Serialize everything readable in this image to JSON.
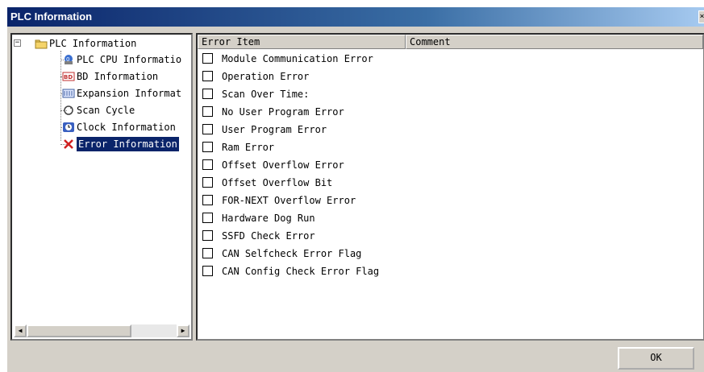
{
  "window": {
    "title": "PLC Information"
  },
  "tree": {
    "root": {
      "label": "PLC Information",
      "expander": "−",
      "icon": "folder-icon"
    },
    "items": [
      {
        "label": "PLC CPU Informatio",
        "icon": "cpu-globe-icon",
        "selected": false
      },
      {
        "label": "BD Information",
        "icon": "bd-board-icon",
        "selected": false
      },
      {
        "label": "Expansion Informat",
        "icon": "expansion-module-icon",
        "selected": false
      },
      {
        "label": "Scan Cycle",
        "icon": "refresh-cycle-icon",
        "selected": false
      },
      {
        "label": "Clock Information",
        "icon": "clock-icon",
        "selected": false
      },
      {
        "label": "Error Information",
        "icon": "error-x-icon",
        "selected": true
      }
    ]
  },
  "list": {
    "columns": [
      "Error Item",
      "Comment"
    ],
    "errors": [
      {
        "label": "Module Communication Error",
        "checked": false
      },
      {
        "label": "Operation Error",
        "checked": false
      },
      {
        "label": "Scan Over Time:",
        "checked": false
      },
      {
        "label": "No User Program Error",
        "checked": false
      },
      {
        "label": "User Program Error",
        "checked": false
      },
      {
        "label": "Ram Error",
        "checked": false
      },
      {
        "label": "Offset Overflow Error",
        "checked": false
      },
      {
        "label": "Offset Overflow Bit",
        "checked": false
      },
      {
        "label": "FOR-NEXT Overflow Error",
        "checked": false
      },
      {
        "label": "Hardware Dog Run",
        "checked": false
      },
      {
        "label": "SSFD Check Error",
        "checked": false
      },
      {
        "label": "CAN Selfcheck Error Flag",
        "checked": false
      },
      {
        "label": "CAN Config Check Error Flag",
        "checked": false
      }
    ]
  },
  "buttons": {
    "ok": "OK"
  }
}
